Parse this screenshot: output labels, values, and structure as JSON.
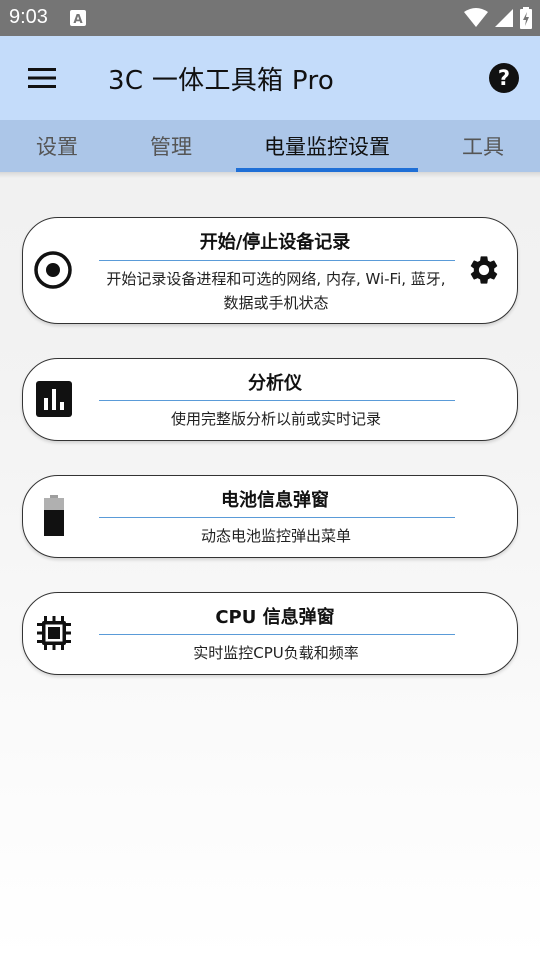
{
  "status_bar": {
    "time": "9:03"
  },
  "app_bar": {
    "title": "3C 一体工具箱 Pro"
  },
  "tabs": [
    {
      "label": "设置"
    },
    {
      "label": "管理"
    },
    {
      "label": "电量监控设置"
    },
    {
      "label": "工具"
    }
  ],
  "active_tab": 2,
  "cards": [
    {
      "title": "开始/停止设备记录",
      "desc_line1": "开始记录设备进程和可选的网络, 内存, Wi-Fi, 蓝牙,",
      "desc_line2": "数据或手机状态",
      "icon": "record-icon",
      "action_icon": "gear-icon"
    },
    {
      "title": "分析仪",
      "desc": "使用完整版分析以前或实时记录",
      "icon": "bar-chart-icon"
    },
    {
      "title": "电池信息弹窗",
      "desc": "动态电池监控弹出菜单",
      "icon": "battery-icon"
    },
    {
      "title": "CPU 信息弹窗",
      "desc": "实时监控CPU负载和频率",
      "icon": "cpu-chip-icon"
    }
  ],
  "colors": {
    "status_bar": "#757575",
    "app_bar": "#c4dcfa",
    "tab_bar": "#acc6e8",
    "tab_indicator": "#1f6fd6",
    "divider": "#5a9bd8"
  }
}
